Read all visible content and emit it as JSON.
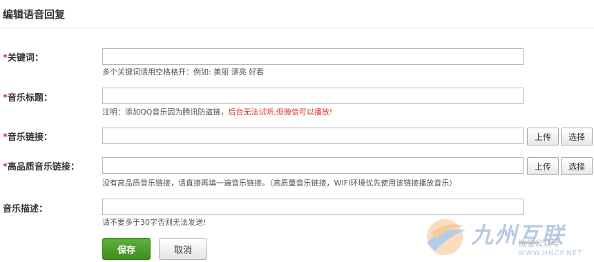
{
  "page": {
    "title": "编辑语音回复"
  },
  "fields": {
    "keywords": {
      "required_mark": "*",
      "label": "关键词：",
      "value": "",
      "hint": "多个关键词请用空格格开：例如: 美丽 漂亮 好看"
    },
    "music_title": {
      "required_mark": "*",
      "label": "音乐标题：",
      "value": "",
      "hint": "注明：添加QQ音乐因为腾讯防盗链，",
      "hint_warning": "后台无法试听,但微信可以播放!"
    },
    "music_link": {
      "required_mark": "*",
      "label": "音乐链接：",
      "value": "",
      "upload_label": "上传",
      "select_label": "选择"
    },
    "hq_music_link": {
      "required_mark": "*",
      "label": "高品质音乐链接：",
      "value": "",
      "upload_label": "上传",
      "select_label": "选择",
      "hint": "没有高品质音乐链接，请直接再填一遍音乐链接。（高质量音乐链接，WIFI环境优先使用该链接播放音乐）"
    },
    "music_description": {
      "label": "音乐描述：",
      "value": "",
      "hint": "请不要多于30字否则无法发送!"
    }
  },
  "actions": {
    "save_label": "保存",
    "cancel_label": "取消"
  },
  "watermark": {
    "brand": "九州互联",
    "sub": "微信公众号",
    "url": "WWW.HNCP.NET"
  },
  "colors": {
    "accent_green": "#4a9d27",
    "required_red": "#d9312b"
  }
}
